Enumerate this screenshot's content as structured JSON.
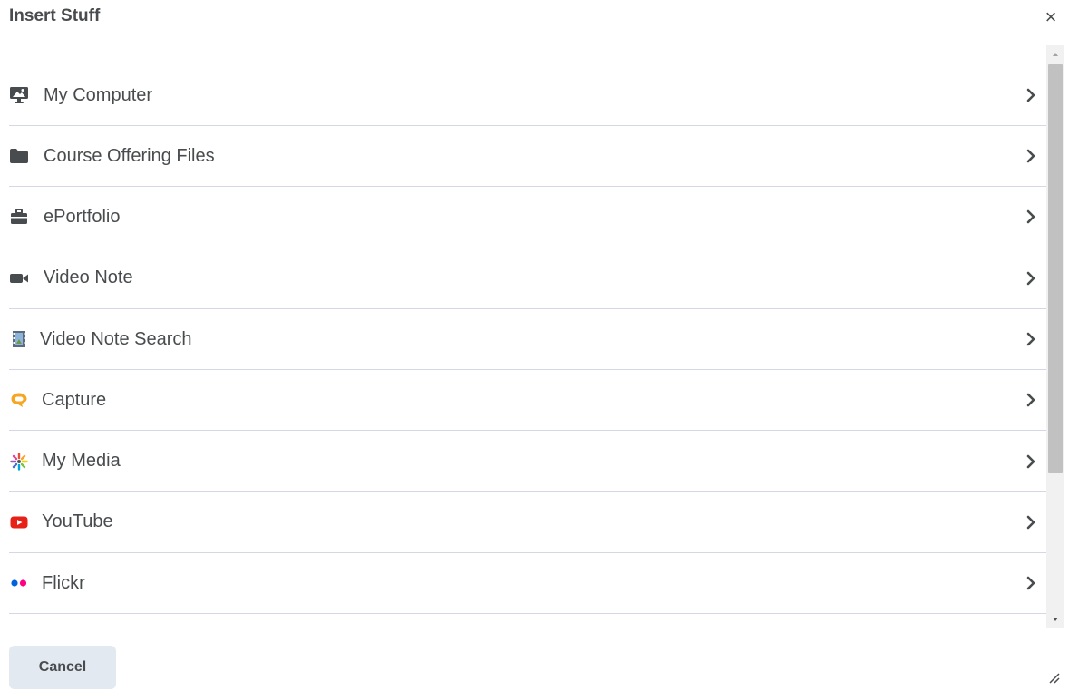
{
  "dialog": {
    "title": "Insert Stuff",
    "close_label": "×",
    "cancel_label": "Cancel"
  },
  "items": [
    {
      "label": "My Computer",
      "icon": "desktop-icon"
    },
    {
      "label": "Course Offering Files",
      "icon": "folder-icon"
    },
    {
      "label": "ePortfolio",
      "icon": "briefcase-icon"
    },
    {
      "label": "Video Note",
      "icon": "video-camera-icon"
    },
    {
      "label": "Video Note Search",
      "icon": "film-icon"
    },
    {
      "label": "Capture",
      "icon": "capture-icon"
    },
    {
      "label": "My Media",
      "icon": "my-media-icon"
    },
    {
      "label": "YouTube",
      "icon": "youtube-icon"
    },
    {
      "label": "Flickr",
      "icon": "flickr-icon"
    }
  ],
  "colors": {
    "text": "#494c4e",
    "divider": "#d3d9e3",
    "cancel_bg": "#e3e9f1",
    "capture": "#f5a623",
    "youtube": "#e62117",
    "flickr_blue": "#0063dc",
    "flickr_pink": "#ff0084"
  }
}
